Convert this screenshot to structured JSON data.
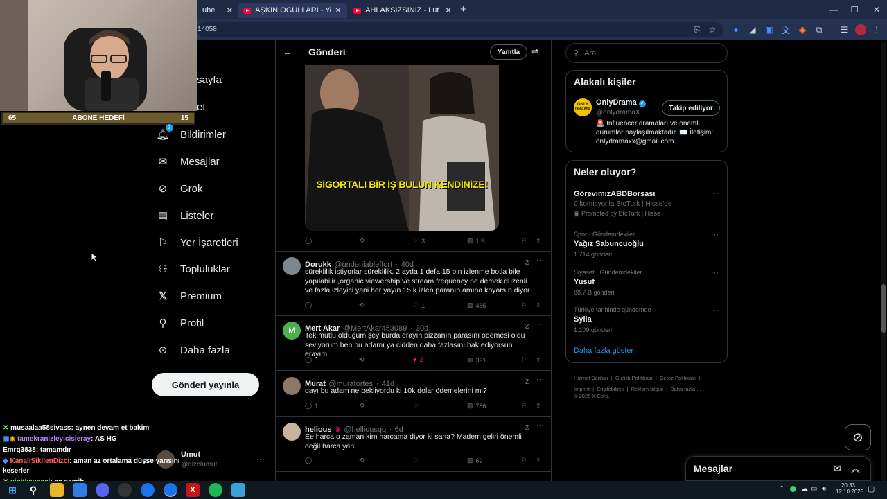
{
  "browser": {
    "tabs": [
      {
        "title": "ube"
      },
      {
        "title": "AŞKIN OGULLARI - YouTube"
      },
      {
        "title": "AHLAKSIZSINIZ - Lut kavminde"
      }
    ],
    "address_fragment": "14058",
    "new_tab": "+"
  },
  "stream": {
    "goal_left": "65",
    "goal_label": "ABONE HEDEFİ",
    "goal_right": "15",
    "chat": [
      {
        "user": "musaalaa58sivass",
        "message": ": aynen devam et bakim",
        "color": "#ffffff"
      },
      {
        "user": "tamekranizleyicisieray",
        "message": ": AS HG",
        "color": "#b388ff"
      },
      {
        "user": "Emrq3838",
        "message": ": tamamdır",
        "color": "#ffffff"
      },
      {
        "user": "KanaliSikilenDizci",
        "message": ": aman az ortalama düşse yarısını",
        "color": "#ff5c5c"
      },
      {
        "user": "",
        "message": "keserler",
        "color": "#ffffff"
      },
      {
        "user": "yigitkavgaci",
        "message": ": as semih",
        "color": "#7cfc5a"
      }
    ]
  },
  "nav": {
    "partial_home": "sayfa",
    "partial_explore": "et",
    "items": [
      {
        "label": "Bildirimler",
        "icon": "bell-icon",
        "badge": "3"
      },
      {
        "label": "Mesajlar",
        "icon": "mail-icon"
      },
      {
        "label": "Grok",
        "icon": "grok-icon"
      },
      {
        "label": "Listeler",
        "icon": "list-icon"
      },
      {
        "label": "Yer İşaretleri",
        "icon": "bookmark-icon"
      },
      {
        "label": "Topluluklar",
        "icon": "communities-icon"
      },
      {
        "label": "Premium",
        "icon": "x-logo-icon"
      },
      {
        "label": "Profil",
        "icon": "profile-icon"
      },
      {
        "label": "Daha fazla",
        "icon": "more-circle-icon"
      }
    ],
    "post_button": "Gönderi yayınla",
    "account": {
      "name": "Umut",
      "handle": "@dizclumut",
      "more": "···"
    }
  },
  "header": {
    "title": "Gönderi",
    "reply_button": "Yanıtla"
  },
  "main_post": {
    "video_caption": "SİGORTALI BİR İŞ BULUN KENDİNİZE!",
    "likes": "3",
    "views": "1 B"
  },
  "replies": [
    {
      "name": "Dorukk",
      "handle": "@undeniableffort",
      "time": "40d",
      "text": "süreklilik istiyorlar süreklilik, 2 ayda 1 defa 15 bin izlenme botla bile yapılabilir ,organic viewership ve stream frequency ne demek düzenli ve fazla izleyici yani her yayın 15 k izlen paranın amına koyarsın diyor",
      "replies": "",
      "likes": "1",
      "views": "485",
      "liked": false
    },
    {
      "name": "Mert Akar",
      "handle": "@MertAkar453089",
      "time": "30d",
      "text": "Tek mutlu olduğum şey burda erayın pizzanın parasını ödemesi oldu seviyorum ben bu adamı ya cidden daha fazlasını hak ediyorsun erayım",
      "replies": "",
      "likes": "2",
      "views": "391",
      "liked": true,
      "avatar_letter": "M"
    },
    {
      "name": "Murat",
      "handle": "@muratortes",
      "time": "41d",
      "text": "dayı bu adam ne bekliyordu ki 10k dolar ödemelerini mi?",
      "replies": "1",
      "likes": "",
      "views": "786",
      "liked": false
    },
    {
      "name": "helious",
      "handle": "@helliousqq",
      "time": "6d",
      "text": "Ee harca o zaman kim harcama diyor ki sana? Madem geliri önemli değil harca yani",
      "replies": "",
      "likes": "",
      "views": "69",
      "liked": false
    }
  ],
  "search": {
    "placeholder": "Ara"
  },
  "related": {
    "title": "Alakalı kişiler",
    "name": "OnlyDrama",
    "handle": "@onlydramaX",
    "follow_button": "Takip ediliyor",
    "bio": "🚨 Influencer dramaları ve önemli durumlar paylaşılmaktadır. ✉️ İletişim: onlydramaxx@gmail.com",
    "avatar_text": "ONLY DRAMA"
  },
  "trends": {
    "title": "Neler oluyor?",
    "items": [
      {
        "context": "",
        "name": "GörevimizABDBorsası",
        "sub": "0 komisyonla BtcTurk | Hisse'de",
        "extra": "Promoted by BtcTurk | Hisse"
      },
      {
        "context": "Spor · Gündemdekiler",
        "name": "Yağız Sabuncuoğlu",
        "sub": "1.714 gönderi",
        "extra": ""
      },
      {
        "context": "Siyaset · Gündemdekiler",
        "name": "Yusuf",
        "sub": "88,7 B gönderi",
        "extra": ""
      },
      {
        "context": "Türkiye tarihinde gündemde",
        "name": "Sylla",
        "sub": "1.109 gönderi",
        "extra": ""
      }
    ],
    "show_more": "Daha fazla göster"
  },
  "footer": {
    "links": [
      "Hizmet Şartları",
      "Gizlilik Politikası",
      "Çerez Politikası",
      "Imprint",
      "Erişilebilirlik",
      "Reklam bilgisi",
      "Daha fazla ..."
    ],
    "copyright": "© 2025 X Corp."
  },
  "messages_drawer": {
    "title": "Mesajlar"
  },
  "taskbar": {
    "time": "20:33",
    "date": "12.10.2025"
  },
  "colors": {
    "accent": "#1d9bf0",
    "like": "#f91880",
    "border": "#2f3336"
  }
}
